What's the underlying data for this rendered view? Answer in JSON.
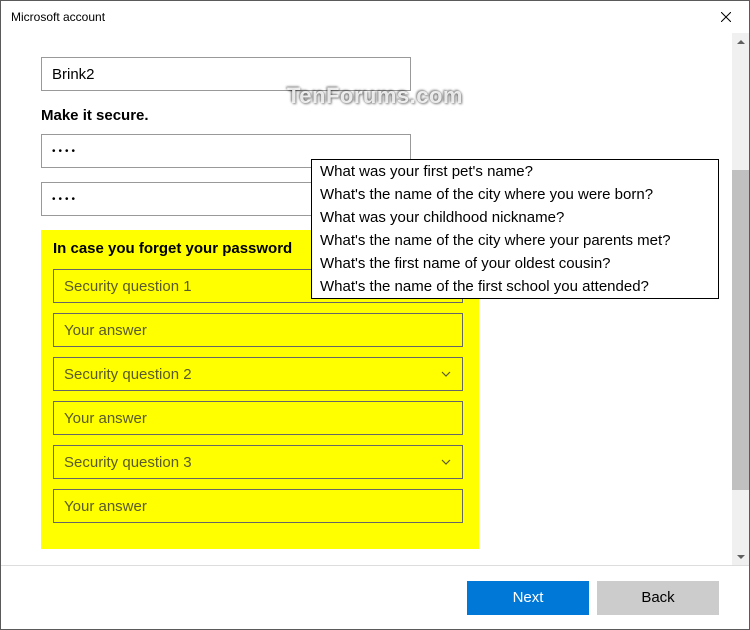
{
  "titlebar": {
    "title": "Microsoft account"
  },
  "form": {
    "username_value": "Brink2",
    "secure_label": "Make it secure.",
    "password1_mask": "••••",
    "password2_mask": "••••"
  },
  "security": {
    "heading": "In case you forget your password",
    "q1_placeholder": "Security question 1",
    "a1_placeholder": "Your answer",
    "q2_placeholder": "Security question 2",
    "a2_placeholder": "Your answer",
    "q3_placeholder": "Security question 3",
    "a3_placeholder": "Your answer"
  },
  "dropdown": {
    "options": [
      "What was your first pet's name?",
      "What's the name of the city where you were born?",
      "What was your childhood nickname?",
      "What's the name of the city where your parents met?",
      "What's the first name of your oldest cousin?",
      "What's the name of the first school you attended?"
    ]
  },
  "footer": {
    "next_label": "Next",
    "back_label": "Back"
  },
  "watermark": "TenForums.com"
}
